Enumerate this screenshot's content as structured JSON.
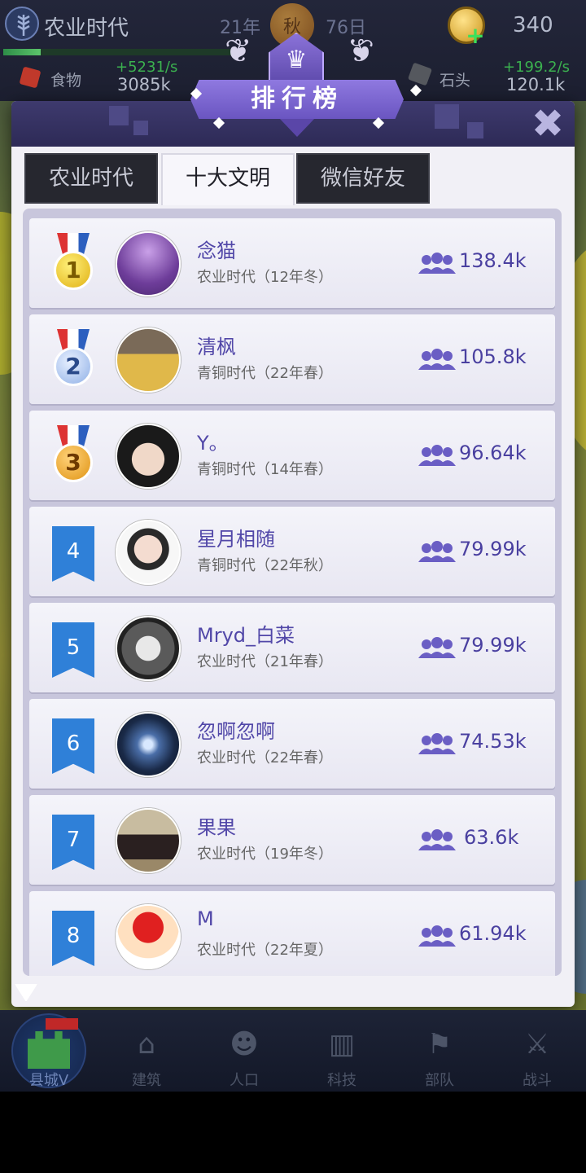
{
  "hud": {
    "era_title": "农业时代",
    "year": "21年",
    "season": "秋",
    "day": "76日",
    "coins": "340",
    "resources": [
      {
        "name": "食物",
        "rate": "+5231/s",
        "amount": "3085k",
        "icon": "food-icon"
      },
      {
        "name": "石头",
        "rate": "+199.2/s",
        "amount": "120.1k",
        "icon": "stone-icon"
      }
    ],
    "era_progress_fraction": 0.16
  },
  "modal": {
    "title": "排行榜",
    "close_glyph": "✖",
    "tabs": [
      {
        "label": "农业时代",
        "active": false
      },
      {
        "label": "十大文明",
        "active": true
      },
      {
        "label": "微信好友",
        "active": false
      }
    ]
  },
  "leaderboard": [
    {
      "rank": "1",
      "badge": "gold-medal",
      "name": "念猫",
      "era": "农业时代（12年冬）",
      "population": "138.4k"
    },
    {
      "rank": "2",
      "badge": "silver-medal",
      "name": "清枫",
      "era": "青铜时代（22年春）",
      "population": "105.8k"
    },
    {
      "rank": "3",
      "badge": "bronze-medal",
      "name": "Y。",
      "era": "青铜时代（14年春）",
      "population": "96.64k"
    },
    {
      "rank": "4",
      "badge": "blue-banner",
      "name": "星月相随",
      "era": "青铜时代（22年秋）",
      "population": "79.99k"
    },
    {
      "rank": "5",
      "badge": "blue-banner",
      "name": "Mryd_白菜",
      "era": "农业时代（21年春）",
      "population": "79.99k"
    },
    {
      "rank": "6",
      "badge": "blue-banner",
      "name": "忽啊忽啊",
      "era": "农业时代（22年春）",
      "population": "74.53k"
    },
    {
      "rank": "7",
      "badge": "blue-banner",
      "name": "果果",
      "era": "农业时代（19年冬）",
      "population": "63.6k"
    },
    {
      "rank": "8",
      "badge": "blue-banner",
      "name": "M",
      "era": "农业时代（22年夏）",
      "population": "61.94k"
    }
  ],
  "bottom_nav": [
    {
      "label": "县城V",
      "icon": "castle-icon",
      "current": true
    },
    {
      "label": "建筑",
      "icon": "house-icon",
      "current": false
    },
    {
      "label": "人口",
      "icon": "person-icon",
      "current": false
    },
    {
      "label": "科技",
      "icon": "book-icon",
      "current": false
    },
    {
      "label": "部队",
      "icon": "banner-icon",
      "current": false
    },
    {
      "label": "战斗",
      "icon": "swords-icon",
      "current": false
    }
  ],
  "colors": {
    "accent_purple": "#5147a8",
    "rank_banner_blue": "#2f80d8",
    "hud_bg": "#1c1f30",
    "positive_rate": "#3bb14f"
  }
}
